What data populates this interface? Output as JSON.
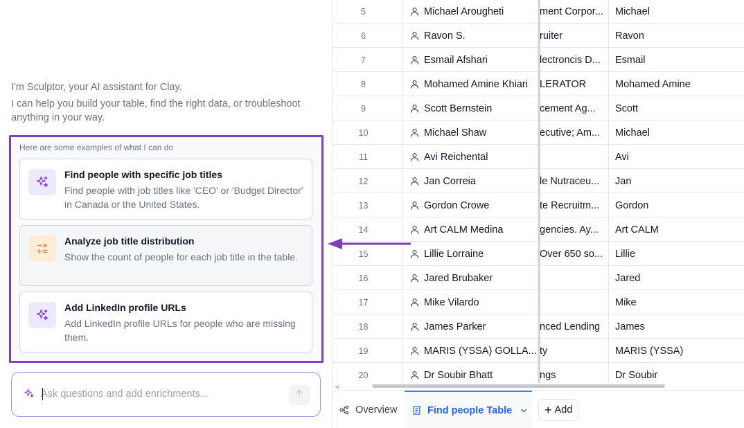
{
  "assistant": {
    "intro_line1": "I'm Sculptor, your AI assistant for Clay.",
    "intro_line2": "I can help you build your table, find the right data, or troubleshoot anything in your way.",
    "examples_title": "Here are some examples of what I can do",
    "examples": [
      {
        "title": "Find people with specific job titles",
        "desc": "Find people with job titles like 'CEO' or 'Budget Director' in Canada or the United States.",
        "icon": "sparkle-icon"
      },
      {
        "title": "Analyze job title distribution",
        "desc": "Show the count of people for each job title in the table.",
        "icon": "calculator-icon"
      },
      {
        "title": "Add LinkedIn profile URLs",
        "desc": "Add LinkedIn profile URLs for people who are missing them.",
        "icon": "sparkle-icon"
      }
    ],
    "input_placeholder": "Ask questions and add enrichments...",
    "accent_color": "#7e3fb8"
  },
  "table": {
    "rows": [
      {
        "num": "5",
        "name": "Michael Arougheti",
        "company": "ment Corpor...",
        "first": "Michael"
      },
      {
        "num": "6",
        "name": "Ravon S.",
        "company": "ruiter",
        "first": "Ravon"
      },
      {
        "num": "7",
        "name": "Esmail Afshari",
        "company": "lectroncis D...",
        "first": "Esmail"
      },
      {
        "num": "8",
        "name": "Mohamed Amine Khiari",
        "company": "LERATOR",
        "first": "Mohamed Amine"
      },
      {
        "num": "9",
        "name": "Scott Bernstein",
        "company": "cement Ag...",
        "first": "Scott"
      },
      {
        "num": "10",
        "name": "Michael Shaw",
        "company": "ecutive; Am...",
        "first": "Michael"
      },
      {
        "num": "11",
        "name": "Avi Reichental",
        "company": "",
        "first": "Avi"
      },
      {
        "num": "12",
        "name": "Jan Correia",
        "company": "le Nutraceu...",
        "first": "Jan"
      },
      {
        "num": "13",
        "name": "Gordon Crowe",
        "company": "te Recruitm...",
        "first": "Gordon"
      },
      {
        "num": "14",
        "name": "Art CALM Medina",
        "company": "gencies. Ay...",
        "first": "Art CALM"
      },
      {
        "num": "15",
        "name": "Lillie Lorraine",
        "company": "Over 650 so...",
        "first": "Lillie"
      },
      {
        "num": "16",
        "name": "Jared Brubaker",
        "company": "",
        "first": "Jared"
      },
      {
        "num": "17",
        "name": "Mike Vilardo",
        "company": "",
        "first": "Mike"
      },
      {
        "num": "18",
        "name": "James Parker",
        "company": "nced Lending",
        "first": "James"
      },
      {
        "num": "19",
        "name": "MARIS (YSSA) GOLLA...",
        "company": "ty",
        "first": "MARIS (YSSA)"
      },
      {
        "num": "20",
        "name": "Dr Soubir Bhatt",
        "company": "ngs",
        "first": "Dr Soubir"
      }
    ]
  },
  "tabs": {
    "overview": "Overview",
    "active": "Find people Table",
    "add": "Add"
  }
}
